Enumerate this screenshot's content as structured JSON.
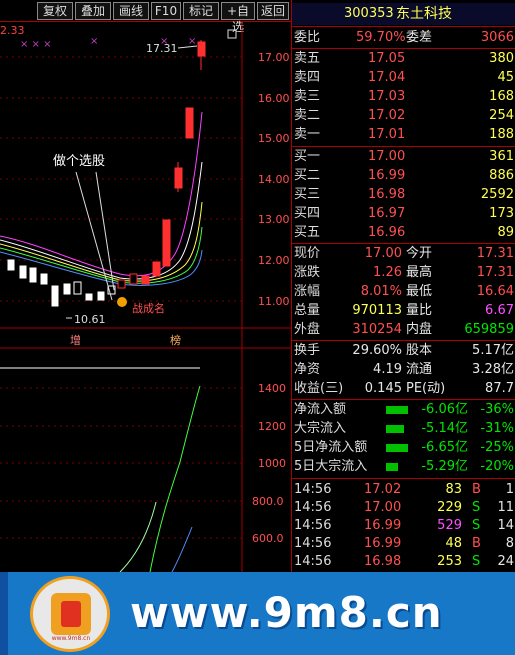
{
  "toolbar": {
    "buttons": [
      "复权",
      "叠加",
      "画线",
      "F10",
      "标记",
      "+自选",
      "返回"
    ]
  },
  "chart": {
    "price_axis": [
      "17.00",
      "16.00",
      "15.00",
      "14.00",
      "13.00",
      "12.00",
      "11.00"
    ],
    "volume_axis": [
      "1400",
      "1200",
      "1000",
      "800.0",
      "600.0"
    ],
    "top_left_value": "2.33",
    "high_label": "17.31",
    "low_label": "10.61",
    "annotation": "做个选股",
    "signal_label": "战成名",
    "bottom_tags": [
      "增",
      "榜"
    ]
  },
  "stock": {
    "code": "300353",
    "name": "东土科技"
  },
  "panel": {
    "weibi": {
      "label": "委比",
      "value": "59.70%",
      "label2": "委差",
      "value2": "3066"
    },
    "sell": [
      {
        "label": "卖五",
        "price": "17.05",
        "vol": "380"
      },
      {
        "label": "卖四",
        "price": "17.04",
        "vol": "45"
      },
      {
        "label": "卖三",
        "price": "17.03",
        "vol": "168"
      },
      {
        "label": "卖二",
        "price": "17.02",
        "vol": "254"
      },
      {
        "label": "卖一",
        "price": "17.01",
        "vol": "188"
      }
    ],
    "buy": [
      {
        "label": "买一",
        "price": "17.00",
        "vol": "361"
      },
      {
        "label": "买二",
        "price": "16.99",
        "vol": "886"
      },
      {
        "label": "买三",
        "price": "16.98",
        "vol": "2592"
      },
      {
        "label": "买四",
        "price": "16.97",
        "vol": "173"
      },
      {
        "label": "买五",
        "price": "16.96",
        "vol": "89"
      }
    ],
    "quote": [
      {
        "l1": "现价",
        "v1": "17.00",
        "l2": "今开",
        "v2": "17.31"
      },
      {
        "l1": "涨跌",
        "v1": "1.26",
        "l2": "最高",
        "v2": "17.31"
      },
      {
        "l1": "涨幅",
        "v1": "8.01%",
        "l2": "最低",
        "v2": "16.64"
      },
      {
        "l1": "总量",
        "v1": "970113",
        "l2": "量比",
        "v2": "6.67"
      },
      {
        "l1": "外盘",
        "v1": "310254",
        "l2": "内盘",
        "v2": "659859"
      }
    ],
    "fund": [
      {
        "l1": "换手",
        "v1": "29.60%",
        "l2": "股本",
        "v2": "5.17亿"
      },
      {
        "l1": "净资",
        "v1": "4.19",
        "l2": "流通",
        "v2": "3.28亿"
      },
      {
        "l1": "收益(三)",
        "v1": "0.145",
        "l2": "PE(动)",
        "v2": "87.7"
      }
    ],
    "flow": [
      {
        "label": "净流入额",
        "amount": "-6.06亿",
        "pct": "-36%"
      },
      {
        "label": "大宗流入",
        "amount": "-5.14亿",
        "pct": "-31%"
      },
      {
        "label": "5日净流入额",
        "amount": "-6.65亿",
        "pct": "-25%"
      },
      {
        "label": "5日大宗流入",
        "amount": "-5.29亿",
        "pct": "-20%"
      }
    ],
    "ticks": [
      {
        "time": "14:56",
        "price": "17.02",
        "vol": "83",
        "side": "B",
        "n": "1"
      },
      {
        "time": "14:56",
        "price": "17.00",
        "vol": "229",
        "side": "S",
        "n": "11"
      },
      {
        "time": "14:56",
        "price": "16.99",
        "vol": "529",
        "side": "S",
        "n": "14"
      },
      {
        "time": "14:56",
        "price": "16.99",
        "vol": "48",
        "side": "B",
        "n": "8"
      },
      {
        "time": "14:56",
        "price": "16.98",
        "vol": "253",
        "side": "S",
        "n": "24"
      }
    ]
  },
  "footer": {
    "url": "www.9m8.cn",
    "logo_url": "www.9m8.cn"
  },
  "colors": {
    "up": "#ff3030",
    "down": "#00e600",
    "bg": "#000000",
    "grid": "#a00000",
    "footer": "#1878c8"
  }
}
